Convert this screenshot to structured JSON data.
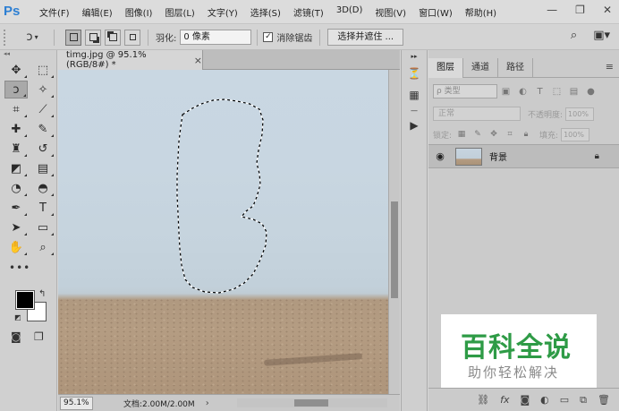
{
  "app": {
    "logo": "Ps",
    "menu": [
      "文件(F)",
      "编辑(E)",
      "图像(I)",
      "图层(L)",
      "文字(Y)",
      "选择(S)",
      "滤镜(T)",
      "3D(D)",
      "视图(V)",
      "窗口(W)",
      "帮助(H)"
    ],
    "window_controls": {
      "minimize": "—",
      "maximize": "❐",
      "close": "✕"
    }
  },
  "options_bar": {
    "feather_label": "羽化:",
    "feather_value": "0 像素",
    "antialias_label": "消除锯齿",
    "antialias_checked": true,
    "select_and_mask": "选择并遮住 ..."
  },
  "document": {
    "tab_title": "timg.jpg @ 95.1%(RGB/8#) *",
    "tab_close": "×",
    "zoom": "95.1%",
    "doc_info": "文档:2.00M/2.00M",
    "status_arrow": "›"
  },
  "tools": [
    {
      "name": "move-tool",
      "glyph": "✥"
    },
    {
      "name": "marquee-tool",
      "glyph": "⬚"
    },
    {
      "name": "lasso-tool",
      "glyph": "ↄ",
      "active": true
    },
    {
      "name": "magic-wand-tool",
      "glyph": "✧"
    },
    {
      "name": "crop-tool",
      "glyph": "⌗"
    },
    {
      "name": "eyedropper-tool",
      "glyph": "⟋"
    },
    {
      "name": "healing-brush-tool",
      "glyph": "✚"
    },
    {
      "name": "brush-tool",
      "glyph": "✎"
    },
    {
      "name": "clone-stamp-tool",
      "glyph": "♜"
    },
    {
      "name": "history-brush-tool",
      "glyph": "↺"
    },
    {
      "name": "eraser-tool",
      "glyph": "◩"
    },
    {
      "name": "gradient-tool",
      "glyph": "▤"
    },
    {
      "name": "blur-tool",
      "glyph": "◔"
    },
    {
      "name": "dodge-tool",
      "glyph": "◓"
    },
    {
      "name": "pen-tool",
      "glyph": "✒"
    },
    {
      "name": "type-tool",
      "glyph": "T"
    },
    {
      "name": "path-selection-tool",
      "glyph": "➤"
    },
    {
      "name": "rectangle-tool",
      "glyph": "▭"
    },
    {
      "name": "hand-tool",
      "glyph": "✋"
    },
    {
      "name": "zoom-tool",
      "glyph": "⌕"
    }
  ],
  "toolbar_more": "•••",
  "panels": {
    "tabs": [
      "图层",
      "通道",
      "路径"
    ],
    "filter_type": "ρ 类型",
    "blend_mode": "正常",
    "opacity_label": "不透明度:",
    "opacity_value": "100%",
    "lock_label": "锁定:",
    "fill_label": "填充:",
    "fill_value": "100%",
    "layers": [
      {
        "name": "背景",
        "visible": true,
        "locked": true
      }
    ]
  },
  "watermark": {
    "title": "百科全说",
    "subtitle": "助你轻松解决"
  },
  "colors": {
    "accent": "#2d7fd3",
    "watermark_green": "#2e9b46",
    "foreground": "#000000",
    "background": "#ffffff"
  }
}
